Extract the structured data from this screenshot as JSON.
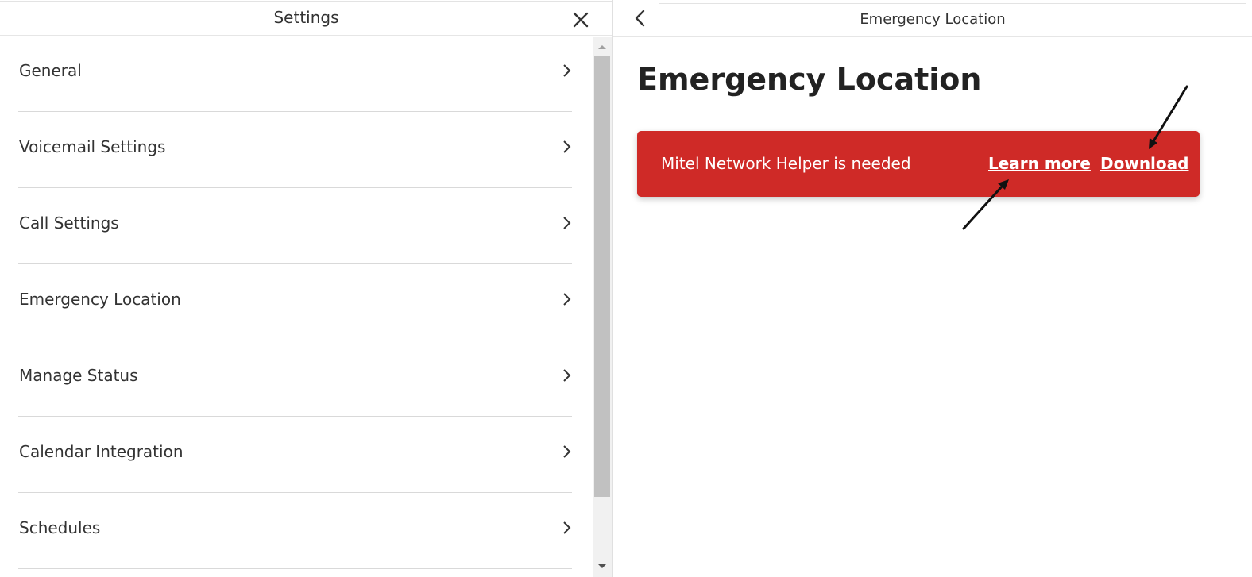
{
  "settings": {
    "title": "Settings",
    "items": [
      {
        "label": "General"
      },
      {
        "label": "Voicemail Settings"
      },
      {
        "label": "Call Settings"
      },
      {
        "label": "Emergency Location"
      },
      {
        "label": "Manage Status"
      },
      {
        "label": "Calendar Integration"
      },
      {
        "label": "Schedules"
      }
    ]
  },
  "detail": {
    "header_title": "Emergency Location",
    "page_title": "Emergency Location",
    "banner": {
      "message": "Mitel Network Helper is needed",
      "learn_more_label": "Learn more",
      "download_label": "Download",
      "color": "#cf2a27"
    }
  },
  "icons": {
    "close": "close-icon",
    "chevron": "chevron-right-icon",
    "back": "chevron-left-icon"
  }
}
